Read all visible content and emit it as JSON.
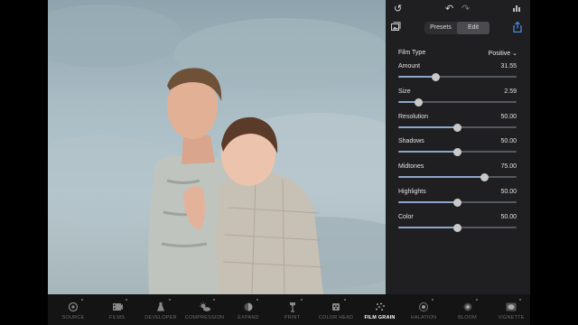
{
  "toolbar_top": {
    "undo_icon": "undo-arrow-icon",
    "undo2_icon": "undo-icon",
    "redo_icon": "redo-icon",
    "histogram_icon": "histogram-icon",
    "gallery_icon": "image-stack-icon",
    "share_icon": "share-icon"
  },
  "tabs": {
    "presets": "Presets",
    "edit": "Edit",
    "active": "Edit"
  },
  "film_type": {
    "label": "Film Type",
    "value": "Positive"
  },
  "params": [
    {
      "label": "Amount",
      "value": "31.55",
      "fraction": 0.32
    },
    {
      "label": "Size",
      "value": "2.59",
      "fraction": 0.17
    },
    {
      "label": "Resolution",
      "value": "50.00",
      "fraction": 0.5
    },
    {
      "label": "Shadows",
      "value": "50.00",
      "fraction": 0.5
    },
    {
      "label": "Midtones",
      "value": "75.00",
      "fraction": 0.73
    },
    {
      "label": "Highlights",
      "value": "50.00",
      "fraction": 0.5
    },
    {
      "label": "Color",
      "value": "50.00",
      "fraction": 0.5
    }
  ],
  "tools": [
    {
      "name": "SOURCE",
      "icon": "camera-lens-icon",
      "active": false
    },
    {
      "name": "FILMS",
      "icon": "film-icon",
      "active": false
    },
    {
      "name": "DEVELOPER",
      "icon": "flask-icon",
      "active": false
    },
    {
      "name": "COMPRESSION",
      "icon": "sun-cloud-icon",
      "active": false
    },
    {
      "name": "EXPAND",
      "icon": "half-circle-icon",
      "active": false
    },
    {
      "name": "PRINT",
      "icon": "enlarger-icon",
      "active": false
    },
    {
      "name": "COLOR HEAD",
      "icon": "color-head-icon",
      "active": false
    },
    {
      "name": "FILM GRAIN",
      "icon": "grain-icon",
      "active": true
    },
    {
      "name": "HALATION",
      "icon": "halation-icon",
      "active": false
    },
    {
      "name": "BLOOM",
      "icon": "bloom-icon",
      "active": false
    },
    {
      "name": "VIGNETTE",
      "icon": "vignette-icon",
      "active": false
    }
  ],
  "colors": {
    "panel": "#1f1f21",
    "slider_fill": "#8fa6c8",
    "accent_active": "#ffffff"
  }
}
